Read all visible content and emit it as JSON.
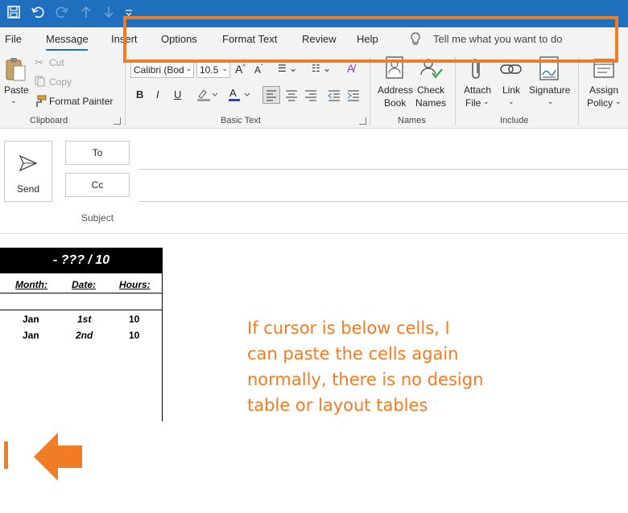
{
  "titlebar": {
    "icons": [
      "save-icon",
      "undo-icon",
      "redo-icon",
      "up-arrow-icon",
      "down-arrow-icon",
      "customize-icon"
    ]
  },
  "menu": {
    "tabs": [
      "File",
      "Message",
      "Insert",
      "Options",
      "Format Text",
      "Review",
      "Help"
    ],
    "active_tab": "Message",
    "tell_me": "Tell me what you want to do"
  },
  "ribbon": {
    "clipboard": {
      "paste": "Paste",
      "cut": "Cut",
      "copy": "Copy",
      "format_painter": "Format Painter",
      "label": "Clipboard"
    },
    "basic_text": {
      "font": "Calibri (Bod",
      "size": "10.5",
      "label": "Basic Text",
      "bold": "B",
      "italic": "I",
      "underline": "U"
    },
    "names": {
      "address_book_1": "Address",
      "address_book_2": "Book",
      "check_names_1": "Check",
      "check_names_2": "Names",
      "label": "Names"
    },
    "include": {
      "attach_1": "Attach",
      "attach_2": "File",
      "link": "Link",
      "signature": "Signature",
      "label": "Include"
    },
    "policy": {
      "assign_1": "Assign",
      "assign_2": "Policy"
    }
  },
  "compose": {
    "send": "Send",
    "to": "To",
    "cc": "Cc",
    "subject": "Subject"
  },
  "table": {
    "title": "- ??? / 10",
    "headers": [
      "Month:",
      "Date:",
      "Hours:"
    ],
    "rows": [
      {
        "month": "Jan",
        "date": "1st",
        "hours": "10"
      },
      {
        "month": "Jan",
        "date": "2nd",
        "hours": "10"
      }
    ]
  },
  "annotation": {
    "line1": "If cursor is below cells, I",
    "line2": "can paste the cells again",
    "line3": "normally, there is no design",
    "line4": "table or layout tables",
    "color": "#f07c26"
  },
  "colors": {
    "titlebar": "#1e6fbe",
    "ribbon": "#f3f3f3",
    "accent": "#f07c26"
  }
}
